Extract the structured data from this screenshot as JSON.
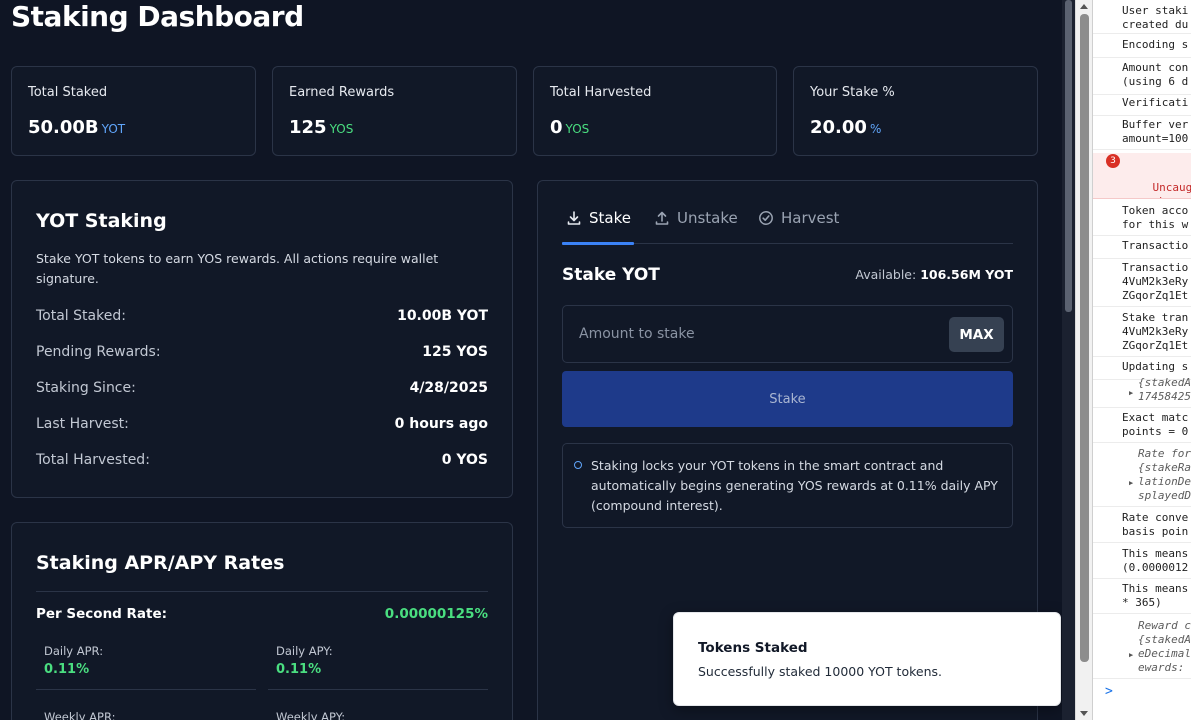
{
  "dashboard": {
    "title": "Staking Dashboard",
    "stats": [
      {
        "label": "Total Staked",
        "value": "50.00B",
        "unit": "YOT",
        "unit_color": "#60a5fa"
      },
      {
        "label": "Earned Rewards",
        "value": "125",
        "unit": "YOS",
        "unit_color": "#4ade80"
      },
      {
        "label": "Total Harvested",
        "value": "0",
        "unit": "YOS",
        "unit_color": "#4ade80"
      },
      {
        "label": "Your Stake %",
        "value": "20.00",
        "unit": "%",
        "unit_color": "#60a5fa"
      }
    ]
  },
  "yot_staking": {
    "title": "YOT Staking",
    "description": "Stake YOT tokens to earn YOS rewards. All actions require wallet signature.",
    "rows": [
      {
        "label": "Total Staked:",
        "value": "10.00B YOT"
      },
      {
        "label": "Pending Rewards:",
        "value": "125 YOS"
      },
      {
        "label": "Staking Since:",
        "value": "4/28/2025"
      },
      {
        "label": "Last Harvest:",
        "value": "0 hours ago"
      },
      {
        "label": "Total Harvested:",
        "value": "0 YOS"
      }
    ]
  },
  "rates": {
    "title": "Staking APR/APY Rates",
    "per_second_label": "Per Second Rate:",
    "per_second_value": "0.00000125%",
    "cells": [
      {
        "label": "Daily APR:",
        "value": "0.11%"
      },
      {
        "label": "Daily APY:",
        "value": "0.11%"
      },
      {
        "label": "Weekly APR:",
        "value": ""
      },
      {
        "label": "Weekly APY:",
        "value": ""
      }
    ]
  },
  "stake_panel": {
    "tabs": [
      {
        "label": "Stake",
        "icon": "download-icon",
        "active": true
      },
      {
        "label": "Unstake",
        "icon": "upload-icon",
        "active": false
      },
      {
        "label": "Harvest",
        "icon": "check-circle-icon",
        "active": false
      }
    ],
    "heading": "Stake YOT",
    "available_label": "Available:",
    "available_value": "106.56M YOT",
    "amount_placeholder": "Amount to stake",
    "amount_value": "",
    "max_label": "MAX",
    "stake_button": "Stake",
    "info_text": "Staking locks your YOT tokens in the smart contract and automatically begins generating YOS rewards at 0.11% daily APY (compound interest).",
    "accent_color": "#3b82f6",
    "button_color": "#1e3a8a"
  },
  "toast": {
    "title": "Tokens Staked",
    "message": "Successfully staked 10000 YOT tokens."
  },
  "console": {
    "error_count": "3",
    "lines": [
      {
        "text": "User staki\ncreated du",
        "kind": "log"
      },
      {
        "text": "Encoding s",
        "kind": "log"
      },
      {
        "text": "Amount con\n(using 6 d",
        "kind": "log"
      },
      {
        "text": "Verificati",
        "kind": "log"
      },
      {
        "text": "Buffer ver\namount=100",
        "kind": "log"
      },
      {
        "text": "Uncaught (\nasynchrono\nclosed bef",
        "kind": "error"
      },
      {
        "text": "Token acco\nfor this w",
        "kind": "log"
      },
      {
        "text": "Transactio",
        "kind": "log"
      },
      {
        "text": "Transactio\n4VuM2k3eRy\nZGqorZq1Et",
        "kind": "log"
      },
      {
        "text": "Stake tran\n4VuM2k3eRy\nZGqorZq1Et",
        "kind": "log"
      },
      {
        "text": "Updating s",
        "kind": "log"
      },
      {
        "text": "{stakedA\n17458425",
        "kind": "object"
      },
      {
        "text": "Exact matc\npoints = 0",
        "kind": "log"
      },
      {
        "text": "Rate for r\n{stakeRa\nlationDe\nsplayedD",
        "kind": "object"
      },
      {
        "text": "Rate conve\nbasis poin",
        "kind": "log"
      },
      {
        "text": "This means\n(0.0000012",
        "kind": "log"
      },
      {
        "text": "This means\n* 365)",
        "kind": "log"
      },
      {
        "text": "Reward cal\n{stakedA\neDecimal\newards:",
        "kind": "object"
      }
    ],
    "prompt": ">"
  }
}
